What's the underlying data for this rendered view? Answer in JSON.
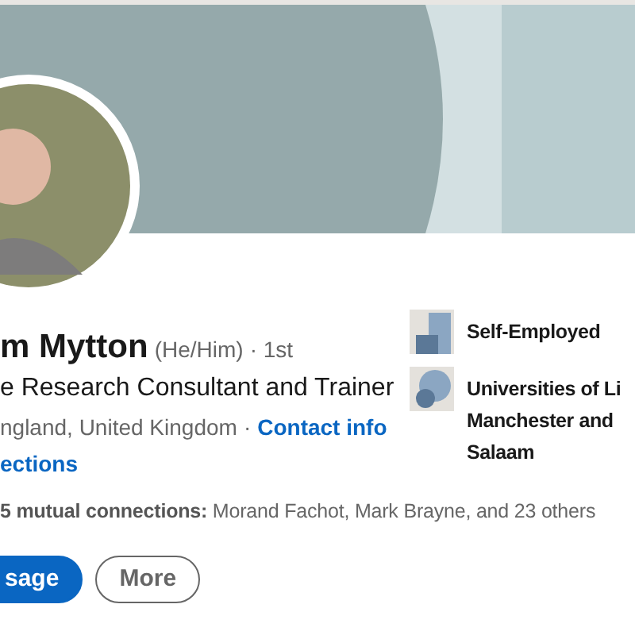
{
  "profile": {
    "name": "m Mytton",
    "pronouns": "(He/Him)",
    "degree": "· 1st",
    "headline": "e Research Consultant and Trainer",
    "location": "ngland, United Kingdom",
    "separator": "·",
    "contact_link": "Contact info",
    "connections_link": "ections",
    "mutual": "**5 mutual connections:** Morand Fachot, Mark Brayne, and 23 others"
  },
  "buttons": [
    {
      "label": "sage",
      "kind": "primary"
    },
    {
      "label": "More",
      "kind": "outline"
    }
  ],
  "experience": [
    {
      "kind": "company",
      "lines": [
        "Self-Employed"
      ]
    },
    {
      "kind": "school",
      "lines": [
        "Universities of Li",
        "Manchester and",
        "Salaam"
      ]
    }
  ]
}
